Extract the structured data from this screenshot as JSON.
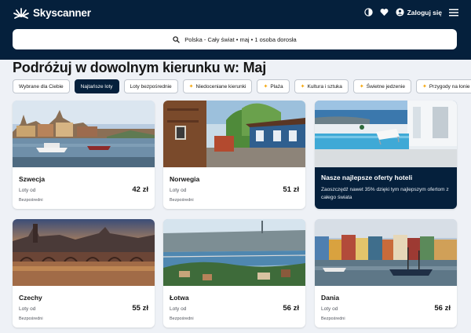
{
  "header": {
    "brand": "Skyscanner",
    "login_label": "Zaloguj się",
    "icons": [
      "sun-logo-icon",
      "globe-icon",
      "heart-icon",
      "user-icon",
      "menu-icon"
    ]
  },
  "search": {
    "summary": "Polska - Cały świat  •  maj  •  1 osoba dorosła",
    "icon": "search-icon"
  },
  "page": {
    "title": "Podróżuj w dowolnym kierunku w: Maj"
  },
  "filters": [
    {
      "label": "Wybrane dla Ciebie",
      "active": false,
      "spark": false
    },
    {
      "label": "Najtańsze loty",
      "active": true,
      "spark": false
    },
    {
      "label": "Loty bezpośrednie",
      "active": false,
      "spark": false
    },
    {
      "label": "Niedoceniane kierunki",
      "active": false,
      "spark": true
    },
    {
      "label": "Plaża",
      "active": false,
      "spark": true
    },
    {
      "label": "Kultura i sztuka",
      "active": false,
      "spark": true
    },
    {
      "label": "Świetne jedzenie",
      "active": false,
      "spark": true
    },
    {
      "label": "Przygody na łonie",
      "active": false,
      "spark": true
    }
  ],
  "destinations": [
    {
      "name": "Szwecja",
      "flights_label": "Loty od",
      "price": "42 zł",
      "direct": "Bezpośredni"
    },
    {
      "name": "Norwegia",
      "flights_label": "Loty od",
      "price": "51 zł",
      "direct": "Bezpośredni"
    },
    {
      "name": "Czechy",
      "flights_label": "Loty od",
      "price": "55 zł",
      "direct": "Bezpośredni"
    },
    {
      "name": "Łotwa",
      "flights_label": "Loty od",
      "price": "56 zł",
      "direct": "Bezpośredni"
    },
    {
      "name": "Dania",
      "flights_label": "Loty od",
      "price": "56 zł",
      "direct": "Bezpośredni"
    }
  ],
  "promo": {
    "title": "Nasze najlepsze oferty hoteli",
    "text": "Zaoszczędź nawet 35% dzięki tym najlepszym ofertom z całego świata"
  },
  "colors": {
    "navy": "#05203c",
    "accent": "#0062e3",
    "spark": "#f5a300",
    "page_bg": "#eef1f6"
  }
}
